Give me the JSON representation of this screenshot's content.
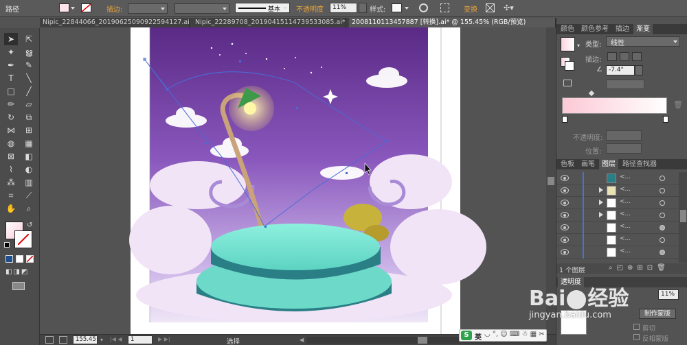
{
  "control_bar": {
    "object_type": "路径",
    "stroke_label": "描边",
    "stroke_unit": ":",
    "stroke_preset": "基本",
    "opacity_label": "不透明度",
    "opacity_value": "11%",
    "style_label": "样式",
    "transform_label": "变换"
  },
  "doc_tabs": [
    {
      "label": "Nipic_22844066_20190625090922594127.ai*",
      "active": false
    },
    {
      "label": "Nipic_22289708_20190415114739533085.ai*",
      "active": false
    },
    {
      "label": "20081101134578​87 [转换].ai* @ 155.45% (RGB/预览)",
      "active": true
    }
  ],
  "gradient_panel": {
    "tabs": [
      "颜色",
      "颜色参考",
      "描边",
      "渐变"
    ],
    "type_label": "类型",
    "type_value": "线性",
    "stroke_label": "描边",
    "angle_value": "-7.4°",
    "opacity_label": "不透明度",
    "position_label": "位置"
  },
  "layers_panel": {
    "tabs": [
      "色板",
      "画笔",
      "图层",
      "路径查找器"
    ],
    "rows": [
      "<...",
      "<...",
      "<...",
      "<...",
      "<...",
      "<...",
      "<...",
      "<..."
    ],
    "footer_count": "1 个图层"
  },
  "transparency_panel": {
    "title": "透明度",
    "opacity_value": "11%",
    "make_mask": "制作蒙版",
    "clip": "剪切",
    "invert_mask": "反相蒙版"
  },
  "status_bar": {
    "zoom": "155.45",
    "page": "1",
    "tool_name": "选择"
  },
  "ime": {
    "lang": "英"
  },
  "watermark": {
    "brand": "Bai",
    "brand2": "经验",
    "url": "jingyan.baidu.com"
  },
  "colors": {
    "accent_orange": "#e8a33b",
    "sky_top": "#5a2a86",
    "platform": "#7fe0cf"
  }
}
